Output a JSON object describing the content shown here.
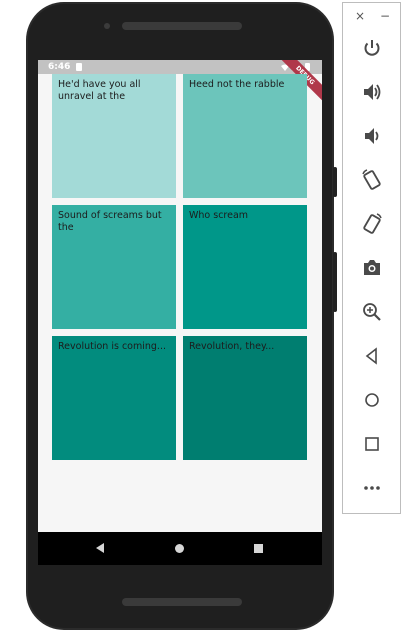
{
  "statusbar": {
    "time": "6:46",
    "debug_banner": "DEBUG"
  },
  "tiles": [
    {
      "text": "He'd have you all unravel at the",
      "color": "#a3dad7"
    },
    {
      "text": "Heed not the rabble",
      "color": "#6cc5bb"
    },
    {
      "text": "Sound of screams but the",
      "color": "#34afa3"
    },
    {
      "text": "Who scream",
      "color": "#009789"
    },
    {
      "text": "Revolution is coming...",
      "color": "#028c7e"
    },
    {
      "text": "Revolution, they...",
      "color": "#007e70"
    }
  ],
  "emulator": {
    "window_controls": {
      "close": "×",
      "minimize": "−"
    },
    "buttons": [
      "power-icon",
      "volume-up-icon",
      "volume-down-icon",
      "rotate-left-icon",
      "rotate-right-icon",
      "camera-icon",
      "zoom-icon",
      "back-icon",
      "home-icon",
      "overview-icon",
      "more-icon"
    ]
  }
}
